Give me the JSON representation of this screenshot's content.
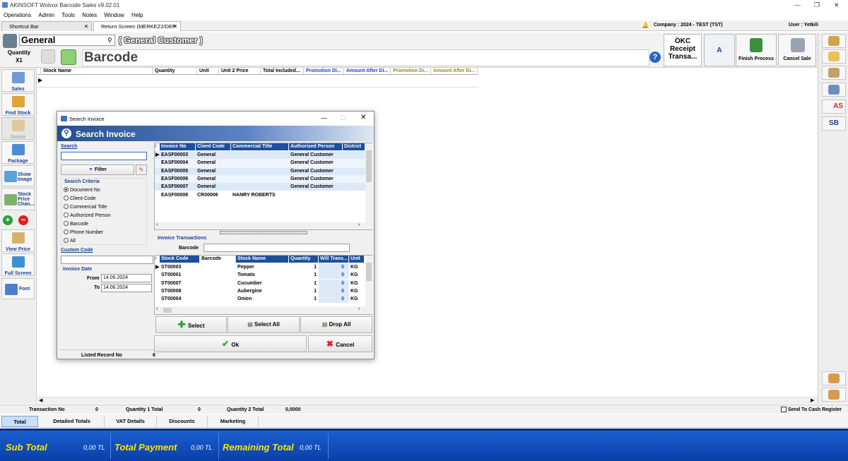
{
  "window": {
    "title": "AKINSOFT Wolvox Barcode Sales v9.02.01"
  },
  "menu": [
    "Operations",
    "Admin",
    "Tools",
    "Notes",
    "Window",
    "Help"
  ],
  "tabs": [
    {
      "label": "Shortcut Bar"
    },
    {
      "label": "Return Screen (MERKEZ2/DEP"
    }
  ],
  "company": "Company : 2024 - TEST (TST)",
  "user": "User : Yetkili",
  "header": {
    "customer_group": "General",
    "customer_name": "( General Customer )",
    "quantity_label": "Quantity",
    "quantity_value": "X1",
    "barcode_label": "Barcode"
  },
  "actions": {
    "okc": "ÖKC Receipt Transa...",
    "a": "A",
    "finish": "Finish Process",
    "cancel": "Cancel Sale"
  },
  "right_buttons": [
    "AS",
    "SB"
  ],
  "left_menu": [
    "Sales",
    "Find Stock",
    "Delete",
    "Package",
    "Show Image",
    "Stock Price Chan...",
    "View Price",
    "Full Screen",
    "Font"
  ],
  "grid_columns": [
    "Stock Name",
    "Quantity",
    "Unit",
    "Unit 2 Price",
    "Total Included...",
    "Promotion Di...",
    "Amount After Di...",
    "Promotion Di...",
    "Amount After Di..."
  ],
  "summary": {
    "transaction_no_label": "Transaction No",
    "transaction_no": "0",
    "qty1_label": "Quantity 1 Total",
    "qty1": "0",
    "qty2_label": "Quantity 2 Total",
    "qty2": "0,0000",
    "send_label": "Send To Cash Register"
  },
  "bottom_tabs": [
    "Total",
    "Detailed Totals",
    "VAT Details",
    "Discounts",
    "Marketing"
  ],
  "totals": {
    "sub_total_label": "Sub Total",
    "sub_total": "0,00 TL",
    "total_payment_label": "Total Payment",
    "total_payment": "0,00 TL",
    "remaining_label": "Remaining Total",
    "remaining": "0,00 TL"
  },
  "dialog": {
    "title": "Search Invoice",
    "header": "Search Invoice",
    "search_label": "Search",
    "search_value": "",
    "filter_label": "Filter",
    "criteria_label": "Search Criteria",
    "criteria": [
      "Document No",
      "Client Code",
      "Commercial Title",
      "Authorized Person",
      "Barcode",
      "Phone Number",
      "All"
    ],
    "custom_code_label": "Custom Code",
    "invoice_date_label": "Invoice Date",
    "from_label": "From",
    "from_value": "14.06.2024",
    "to_label": "To",
    "to_value": "14.06.2024",
    "listed_label": "Listed Record No",
    "listed_value": "6",
    "invoice_columns": [
      "Invoice No",
      "Client Code",
      "Commercial Title",
      "Authorized Person",
      "District"
    ],
    "invoices": [
      [
        "EASF00003",
        "General",
        "",
        "General Customer",
        ""
      ],
      [
        "EASF00004",
        "General",
        "",
        "General Customer",
        ""
      ],
      [
        "EASF00005",
        "General",
        "",
        "General Customer",
        ""
      ],
      [
        "EASF00006",
        "General",
        "",
        "General Customer",
        ""
      ],
      [
        "EASF00007",
        "General",
        "",
        "General Customer",
        ""
      ],
      [
        "EASF00008",
        "CR00006",
        "HANRY ROBERTS",
        "",
        ""
      ]
    ],
    "transactions_label": "Invoice Transactions",
    "barcode_label": "Barcode",
    "tx_columns": [
      "Stock Code",
      "Barcode",
      "Stock Name",
      "Quantity",
      "Will Trans...",
      "Unit"
    ],
    "transactions": [
      [
        "ST00003",
        "",
        "Pepper",
        "1",
        "0",
        "KG"
      ],
      [
        "ST00001",
        "",
        "Tomato",
        "1",
        "0",
        "KG"
      ],
      [
        "ST00007",
        "",
        "Cucumber",
        "1",
        "0",
        "KG"
      ],
      [
        "ST00008",
        "",
        "Aubergine",
        "1",
        "0",
        "KG"
      ],
      [
        "ST00004",
        "",
        "Onion",
        "1",
        "0",
        "KG"
      ]
    ],
    "select_label": "Select",
    "select_all_label": "Select All",
    "drop_all_label": "Drop All",
    "ok_label": "Ok",
    "cancel_label": "Cancel"
  }
}
